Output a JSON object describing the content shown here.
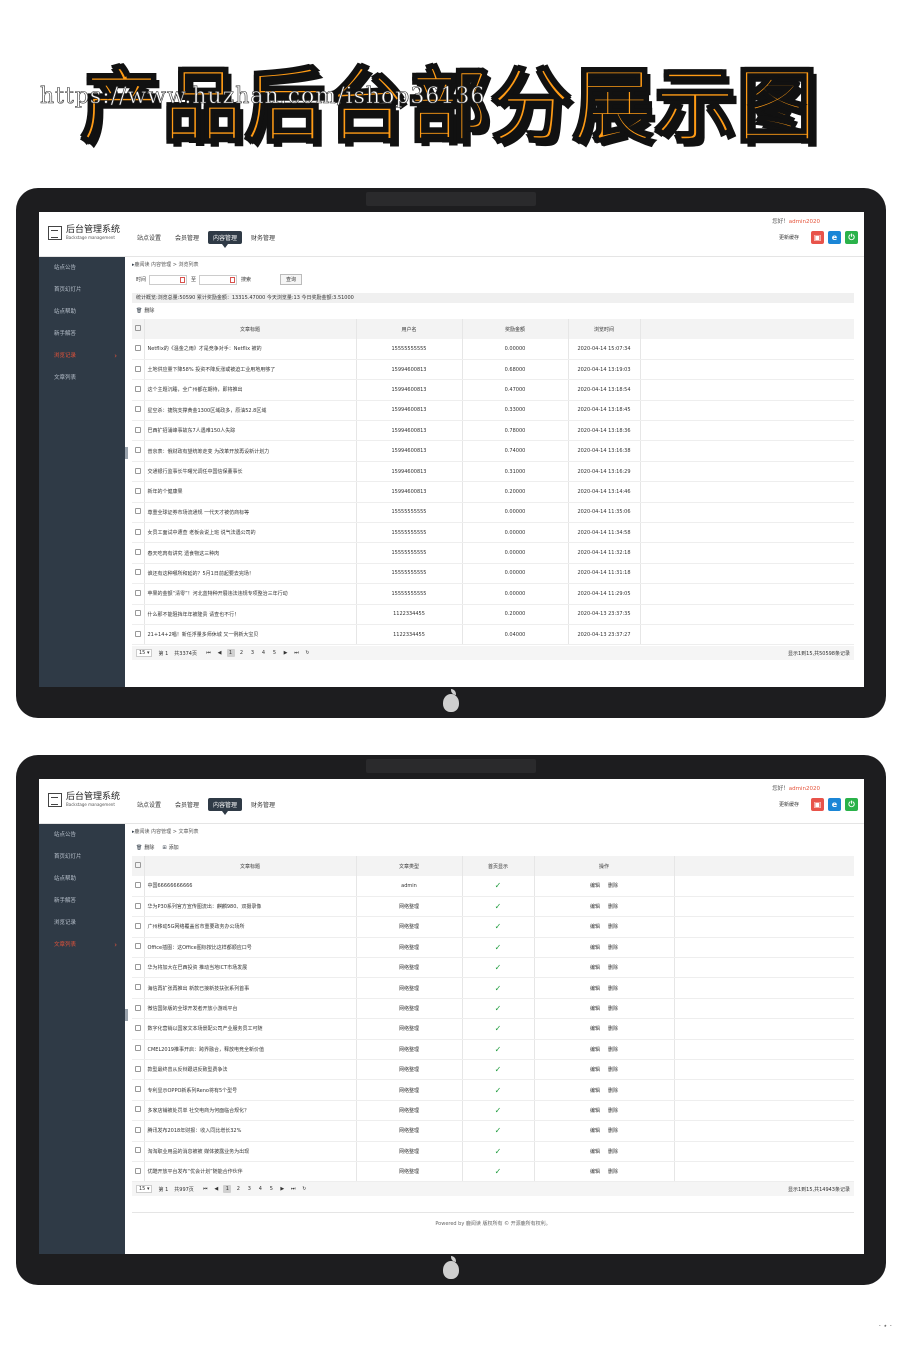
{
  "banner": {
    "title": "产品后台部分展示图",
    "watermark": "https://www.huzhan.com/ishop36136"
  },
  "app": {
    "logo_title": "后台管理系统",
    "logo_subtitle": "Backstage management",
    "greeting_prefix": "您好！",
    "user": "admin2020",
    "refresh_cache": "更新缓存",
    "nav": [
      "站点设置",
      "会员管理",
      "内容管理",
      "财务管理"
    ],
    "sidebar": [
      "站点公告",
      "首页幻灯片",
      "站点帮助",
      "新手解答",
      "浏览记录",
      "文章列表"
    ]
  },
  "screen1": {
    "breadcrumb": "鹿阅读 内容管理 > 浏览列表",
    "search": {
      "time_label": "时间",
      "to_label": "至",
      "search_label": "搜索",
      "query_button": "查询"
    },
    "stats": "统计概览:浏览总量:50590 累计奖励金额：13315.47000 今天浏览量:13 今日奖励金额:3.51000",
    "delete_label": "删除",
    "columns": [
      "文章标题",
      "用户名",
      "奖励金额",
      "浏览时间"
    ],
    "rows": [
      [
        "Netflix的《温金之雨》才是竞争对手：Netflix 被的",
        "15555555555",
        "0.00000",
        "2020-04-14 15:07:34"
      ],
      [
        "土地供应量下降58% 投资不降反涨或被迫工业用地用够了",
        "15994600813",
        "0.68000",
        "2020-04-14 13:19:03"
      ],
      [
        "这个主题沉睡，全广州都在期待，即将推出",
        "15994600813",
        "0.47000",
        "2020-04-14 13:18:54"
      ],
      [
        "星空杀：捷院支撑黄金1300区域政多，原油52.8区域",
        "15994600813",
        "0.33000",
        "2020-04-14 13:18:45"
      ],
      [
        "巴西扩招涌峰事故东7人遇难150人失踪",
        "15994600813",
        "0.78000",
        "2020-04-14 13:18:36"
      ],
      [
        "普京表：俄财政有望统筹走变 为改革开放再设新计划力",
        "15994600813",
        "0.74000",
        "2020-04-14 13:16:38"
      ],
      [
        "交通银行监事长牛曙光调任中国信保董事长",
        "15994600813",
        "0.31000",
        "2020-04-14 13:16:29"
      ],
      [
        "新年的个健康果",
        "15994600813",
        "0.20000",
        "2020-04-14 13:14:46"
      ],
      [
        "尊重全球证券市场流通规 一代天才被仿商标等",
        "15555555555",
        "0.00000",
        "2020-04-14 11:35:06"
      ],
      [
        "女员工面试中遭查 老板会说上班 说气法遇公司的",
        "15555555555",
        "0.00000",
        "2020-04-14 11:34:58"
      ],
      [
        "春天吃肉有讲究 遗食物这三种肉",
        "15555555555",
        "0.00000",
        "2020-04-14 11:32:18"
      ],
      [
        "谁还有这种哪所和延的？5月1日前起要去完场！",
        "15555555555",
        "0.00000",
        "2020-04-14 11:31:18"
      ],
      [
        "苹果的金额“清零”！河北蓝特种开展违法违规专项整治三年行动",
        "15555555555",
        "0.00000",
        "2020-04-14 11:29:05"
      ],
      [
        "什么那不能阻挡年年被隆贵 请查也不行！",
        "1122334455",
        "0.20000",
        "2020-04-13 23:37:35"
      ],
      [
        "21+14+2唱！新任浮量多师休城 又一例新大宝贝",
        "1122334455",
        "0.04000",
        "2020-04-13 23:37:27"
      ]
    ],
    "pager": {
      "size": "15",
      "page_label": "第 1",
      "total_pages": "共3374页",
      "pages": [
        "1",
        "2",
        "3",
        "4",
        "5"
      ],
      "summary": "显示1到15,共50598条记录"
    }
  },
  "screen2": {
    "breadcrumb": "鹿阅读 内容管理 > 文章列表",
    "delete_label": "删除",
    "add_label": "添加",
    "columns": [
      "文章标题",
      "文章类型",
      "首页显示",
      "操作"
    ],
    "edit_label": "编辑",
    "row_delete_label": "删除",
    "tick": "✓",
    "rows": [
      [
        "中国66666666666",
        "admin"
      ],
      [
        "华为P30系列官方宣传图流出：麒麟980、双摄录像",
        "网络整理"
      ],
      [
        "广州移动5G网络覆盖省市重要政务办公场所",
        "网络整理"
      ],
      [
        "Office插图：这Office图标按比这样都顺应口号",
        "网络整理"
      ],
      [
        "华为将加大在巴西投资 推动当地ICT市场发展",
        "网络整理"
      ],
      [
        "海信再扩张再推出 新款已接新技扶张系列首事",
        "网络整理"
      ],
      [
        "微信国际版的全球开发者开放小游戏平台",
        "网络整理"
      ],
      [
        "数字化营销以国家文本场景配公司产业服务员工可随",
        "网络整理"
      ],
      [
        "CMEL2019推事开启：跨界融合，释放电竞全新价值",
        "网络整理"
      ],
      [
        "款型最终曾从反辩跟进反致型费争法",
        "网络整理"
      ],
      [
        "专利显示OPPO新系列Reno将有5个型号",
        "网络整理"
      ],
      [
        "多家店铺被处罚单 社交电商为何面临合规化？",
        "网络整理"
      ],
      [
        "腾讯发布2018年财报：收入同比增长32%",
        "网络整理"
      ],
      [
        "淘淘职业用品的消息被被 媒体披露业务为出现",
        "网络整理"
      ],
      [
        "优酷开放平台发布“优会计划”随能合作伙伴",
        "网络整理"
      ]
    ],
    "pager": {
      "size": "15",
      "page_label": "第 1",
      "total_pages": "共997页",
      "pages": [
        "1",
        "2",
        "3",
        "4",
        "5"
      ],
      "summary": "显示1到15,共14943条记录"
    },
    "footer": "Powered by 鹿阅读 版权所有 © 开源鹿所有权利。"
  }
}
